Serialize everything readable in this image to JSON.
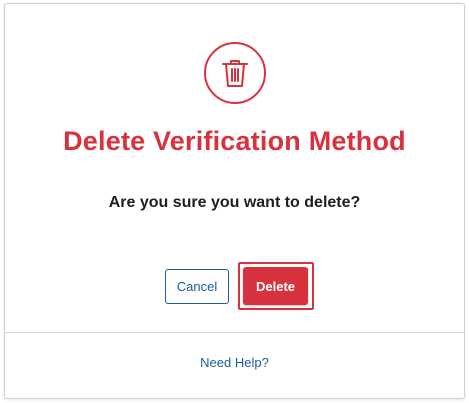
{
  "dialog": {
    "icon": "trash-icon",
    "title": "Delete Verification Method",
    "question": "Are you sure you want to delete?",
    "cancel_label": "Cancel",
    "delete_label": "Delete",
    "help_label": "Need Help?"
  },
  "colors": {
    "danger": "#d9323f",
    "link": "#1d5d9b",
    "text": "#1f1f1f",
    "border": "#cfcfcf"
  }
}
